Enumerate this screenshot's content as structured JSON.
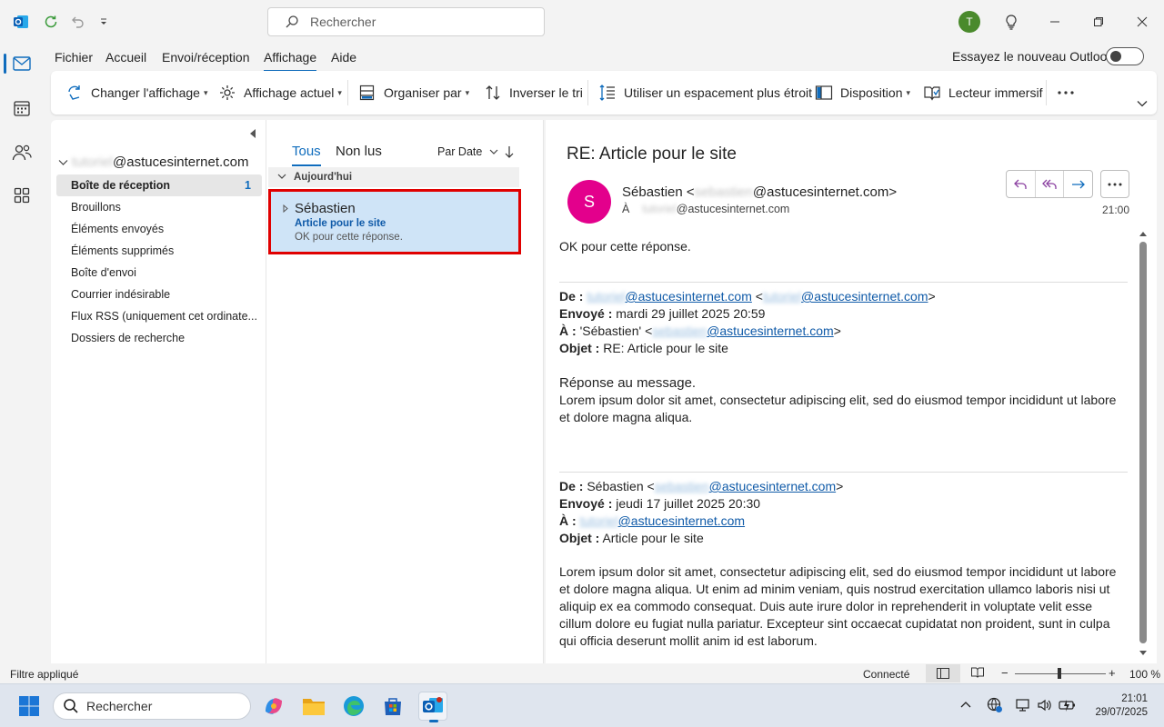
{
  "titlebar": {
    "search_placeholder": "Rechercher",
    "avatar_initial": "T"
  },
  "menu": {
    "tabs": [
      "Fichier",
      "Accueil",
      "Envoi/réception",
      "Affichage",
      "Aide"
    ],
    "active_tab": "Affichage",
    "new_outlook_label": "Essayez le nouveau Outlook"
  },
  "ribbon": {
    "change_view": "Changer l'affichage",
    "current_view": "Affichage actuel",
    "arrange_by": "Organiser par",
    "reverse_sort": "Inverser le tri",
    "compact_spacing": "Utiliser un espacement plus étroit",
    "layout": "Disposition",
    "immersive_reader": "Lecteur immersif"
  },
  "folders": {
    "account_hidden": "tutoriel",
    "account_domain": "@astucesinternet.com",
    "items": [
      {
        "label": "Boîte de réception",
        "count": "1"
      },
      {
        "label": "Brouillons"
      },
      {
        "label": "Éléments envoyés"
      },
      {
        "label": "Éléments supprimés"
      },
      {
        "label": "Boîte d'envoi"
      },
      {
        "label": "Courrier indésirable"
      },
      {
        "label": "Flux RSS (uniquement cet ordinate..."
      },
      {
        "label": "Dossiers de recherche"
      }
    ]
  },
  "list": {
    "tab_all": "Tous",
    "tab_unread": "Non lus",
    "sort_label": "Par Date",
    "group_label": "Aujourd'hui",
    "message": {
      "sender": "Sébastien",
      "subject": "Article pour le site",
      "preview": "OK pour cette réponse."
    }
  },
  "reading": {
    "subject": "RE: Article pour le site",
    "avatar_initial": "S",
    "from_name": "Sébastien <",
    "from_hidden": "sebastien",
    "domain": "@astucesinternet.com",
    "from_close": ">",
    "to_label": "À",
    "to_hidden": "tutoriel",
    "time": "21:00",
    "body_line": "OK pour cette réponse.",
    "q1": {
      "de_label": "De :",
      "de_hidden1": "tutoriel",
      "de_hidden2": "tutoriel",
      "envoye_label": "Envoyé :",
      "envoye_value": "mardi 29 juillet 2025 20:59",
      "a_label": "À :",
      "a_value": "'Sébastien' <",
      "a_hidden": "sebastien",
      "objet_label": "Objet :",
      "objet_value": "RE: Article pour le site",
      "heading": "Réponse au message.",
      "text": "Lorem ipsum dolor sit amet, consectetur adipiscing elit, sed do eiusmod tempor incididunt ut labore et dolore magna aliqua."
    },
    "q2": {
      "de_label": "De :",
      "de_value": "Sébastien <",
      "de_hidden": "sebastien",
      "envoye_label": "Envoyé :",
      "envoye_value": "jeudi 17 juillet 2025 20:30",
      "a_label": "À :",
      "a_hidden": "tutoriel",
      "objet_label": "Objet :",
      "objet_value": "Article pour le site",
      "text": "Lorem ipsum dolor sit amet, consectetur adipiscing elit, sed do eiusmod tempor incididunt ut labore et dolore magna aliqua. Ut enim ad minim veniam, quis nostrud exercitation ullamco laboris nisi ut aliquip ex ea commodo consequat. Duis aute irure dolor in reprehenderit in voluptate velit esse cillum dolore eu fugiat nulla pariatur. Excepteur sint occaecat cupidatat non proident, sunt in culpa qui officia deserunt mollit anim id est laborum."
    }
  },
  "status": {
    "filter": "Filtre appliqué",
    "connection": "Connecté",
    "zoom": "100 %"
  },
  "taskbar": {
    "search_placeholder": "Rechercher",
    "time": "21:01",
    "date": "29/07/2025"
  },
  "colors": {
    "accent": "#0f6cbd",
    "selection_border": "#e00000",
    "selection_fill": "#cfe4f7",
    "avatar_s": "#e3008c",
    "avatar_t": "#4a8a2c"
  }
}
